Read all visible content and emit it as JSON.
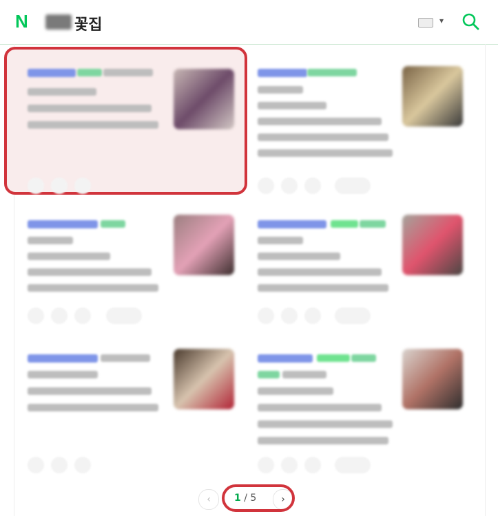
{
  "header": {
    "logo": "N",
    "query_suffix": "꽃집"
  },
  "pagination": {
    "current": "1",
    "separator": "/",
    "total": "5",
    "prev_icon": "chevron-left-icon",
    "next_icon": "chevron-right-icon"
  },
  "colors": {
    "brand_green": "#03c75a",
    "highlight_red": "#d1343c"
  }
}
